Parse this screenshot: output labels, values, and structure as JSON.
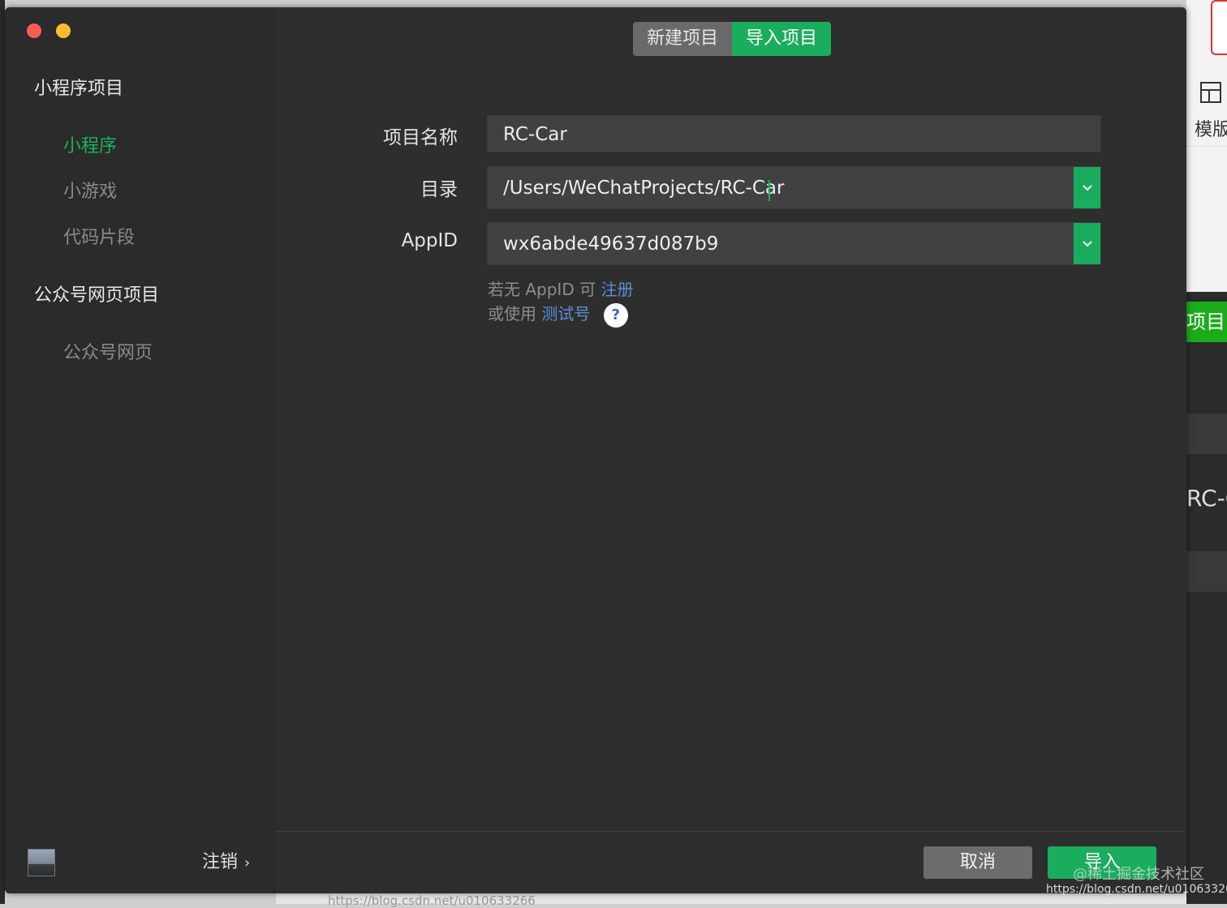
{
  "window": {
    "tabs": [
      {
        "label": "新建项目",
        "active": false
      },
      {
        "label": "导入项目",
        "active": true
      }
    ]
  },
  "sidebar": {
    "groups": [
      {
        "title": "小程序项目",
        "items": [
          {
            "label": "小程序",
            "active": true
          },
          {
            "label": "小游戏",
            "active": false
          },
          {
            "label": "代码片段",
            "active": false
          }
        ]
      },
      {
        "title": "公众号网页项目",
        "items": [
          {
            "label": "公众号网页",
            "active": false
          }
        ]
      }
    ],
    "logout_label": "注销"
  },
  "form": {
    "project_name": {
      "label": "项目名称",
      "value": "RC-Car"
    },
    "directory": {
      "label": "目录",
      "value": "/Users/WeChatProjects/RC-Car"
    },
    "appid": {
      "label": "AppID",
      "value": "wx6abde49637d087b9"
    },
    "hint_line1": {
      "prefix": "若无 AppID 可",
      "link": "注册"
    },
    "hint_line2": {
      "prefix": "或使用",
      "link": "测试号"
    }
  },
  "footer": {
    "cancel_label": "取消",
    "import_label": "导入"
  },
  "background": {
    "template_label": "模版",
    "green_button_fragment": "项目",
    "project_fragment": "RC-C",
    "bottom_url": "https://blog.csdn.net/u010633266"
  },
  "watermark": {
    "line1": "@稀土掘金技术社区",
    "line2": "https://blog.csdn.net/u010633266"
  },
  "colors": {
    "accent": "#1aad5d",
    "link": "#5a8fd6",
    "window_bg": "#2e2e2e",
    "sidebar_bg": "#2b2b2b"
  }
}
